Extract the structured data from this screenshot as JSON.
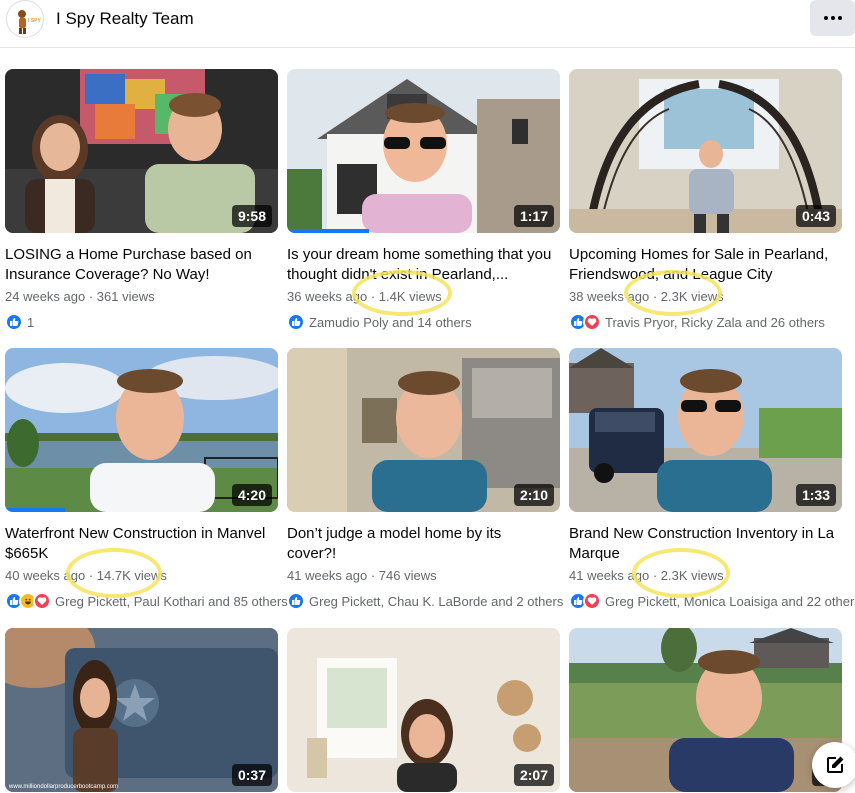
{
  "header": {
    "title": "I Spy Realty Team",
    "avatar_icon": "realty-logo-icon",
    "more_icon": "more-dots-icon"
  },
  "videos": [
    {
      "title_line1": "LOSING a Home Purchase based on",
      "title_line2": "Insurance Coverage? No Way!",
      "meta": "24 weeks ago · 361 views",
      "duration": "9:58",
      "reactions": [
        "like"
      ],
      "reaction_text": "1"
    },
    {
      "title_line1": "Is your dream home something that you",
      "title_line2": "thought didn't exist in Pearland,...",
      "meta": "36 weeks ago · 1.4K views",
      "duration": "1:17",
      "reactions": [
        "like"
      ],
      "reaction_text": "Zamudio Poly and 14 others",
      "progress": 0.3
    },
    {
      "title_line1": "Upcoming Homes for Sale in Pearland,",
      "title_line2": "Friendswood, and League City",
      "meta": "38 weeks ago · 2.3K views",
      "duration": "0:43",
      "reactions": [
        "like",
        "love"
      ],
      "reaction_text": "Travis Pryor, Ricky Zala and 26 others"
    },
    {
      "title_line1": "Waterfront New Construction in Manvel",
      "title_line2": "$665K",
      "meta": "40 weeks ago · 14.7K views",
      "duration": "4:20",
      "reactions": [
        "like",
        "haha",
        "love"
      ],
      "reaction_text": "Greg Pickett, Paul Kothari and 85 others",
      "progress": 0.22
    },
    {
      "title_line1": "Don’t judge a model home by its",
      "title_line2": "cover?!",
      "meta": "41 weeks ago · 746 views",
      "duration": "2:10",
      "reactions": [
        "like"
      ],
      "reaction_text": "Greg Pickett, Chau K. LaBorde and 2 others"
    },
    {
      "title_line1": "Brand New Construction Inventory in La",
      "title_line2": "Marque",
      "meta": "41 weeks ago · 2.3K views",
      "duration": "1:33",
      "reactions": [
        "like",
        "love"
      ],
      "reaction_text": "Greg Pickett, Monica Loaisiga and 22 others"
    },
    {
      "duration": "0:37",
      "watermark": "www.milliondollarproducerbootcamp.com"
    },
    {
      "duration": "2:07"
    },
    {
      "duration": "3:"
    }
  ],
  "compose_icon": "compose-icon",
  "colors": {
    "accent": "#1877f2",
    "highlight": "#f6e35a",
    "muted_text": "#65676b"
  }
}
